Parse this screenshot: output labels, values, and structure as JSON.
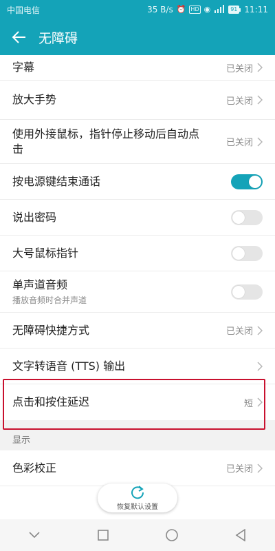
{
  "status_bar": {
    "carrier": "中国电信",
    "speed": "35 B/s",
    "signal_label": "4G",
    "battery": "91",
    "time": "11:11"
  },
  "app_bar": {
    "title": "无障碍"
  },
  "items": [
    {
      "label": "字幕",
      "value": "已关闭",
      "type": "link"
    },
    {
      "label": "放大手势",
      "value": "已关闭",
      "type": "link"
    },
    {
      "label": "使用外接鼠标，指针停止移动后自动点击",
      "value": "已关闭",
      "type": "link"
    },
    {
      "label": "按电源键结束通话",
      "type": "toggle",
      "enabled": true
    },
    {
      "label": "说出密码",
      "type": "toggle",
      "enabled": false
    },
    {
      "label": "大号鼠标指针",
      "type": "toggle",
      "enabled": false
    },
    {
      "label": "单声道音频",
      "sub": "播放音频时合并声道",
      "type": "toggle",
      "enabled": false
    },
    {
      "label": "无障碍快捷方式",
      "value": "已关闭",
      "type": "link"
    },
    {
      "label": "文字转语音 (TTS) 输出",
      "type": "link"
    },
    {
      "label": "点击和按住延迟",
      "value": "短",
      "type": "link"
    }
  ],
  "display_section": {
    "header": "显示",
    "items": [
      {
        "label": "色彩校正",
        "value": "已关闭",
        "type": "link"
      }
    ]
  },
  "restore_button": {
    "label": "恢复默认设置"
  },
  "colors": {
    "accent": "#14a3b8",
    "highlight": "#c8102e"
  }
}
